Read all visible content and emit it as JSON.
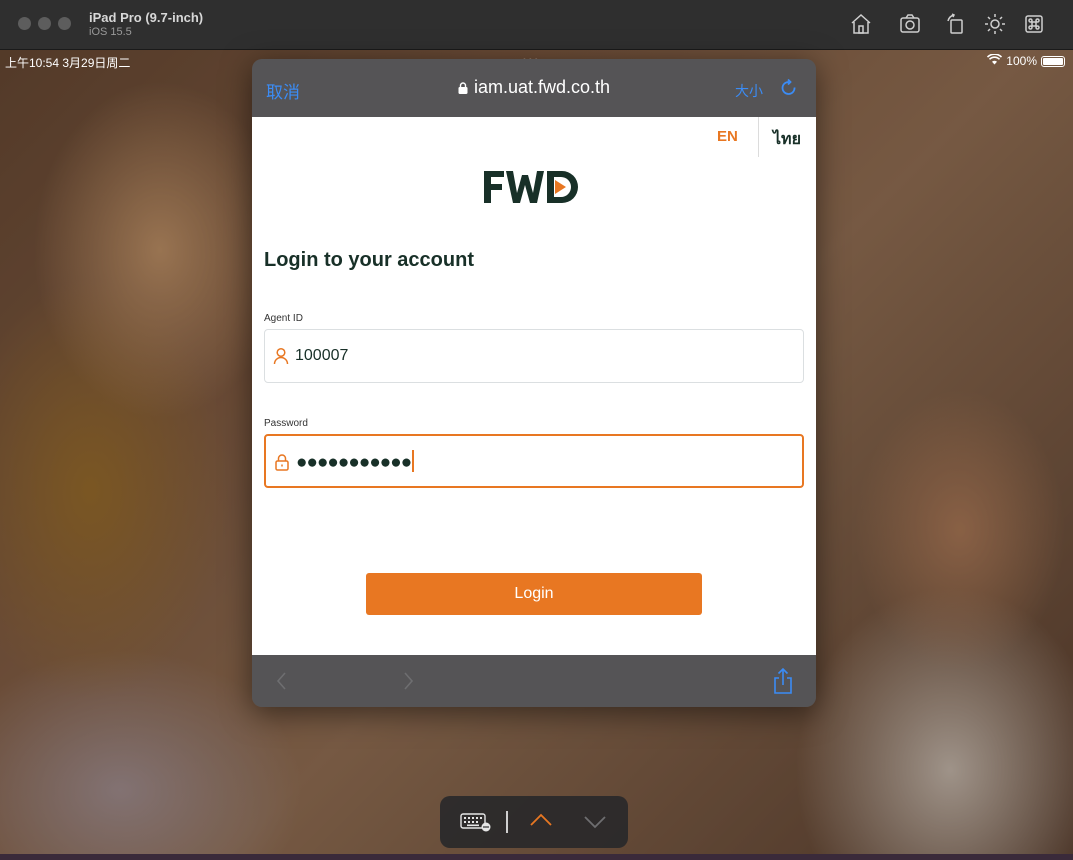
{
  "simulator": {
    "device_name": "iPad Pro (9.7-inch)",
    "os_version": "iOS 15.5",
    "toolbar_icons": [
      "home-icon",
      "screenshot-icon",
      "rotate-icon",
      "appearance-icon",
      "command-icon"
    ]
  },
  "status_bar": {
    "time_date": "上午10:54 3月29日周二",
    "multitask_dots": "•••",
    "battery": "100%",
    "battery_level": 1.0
  },
  "browser": {
    "cancel_label": "取消",
    "url": "iam.uat.fwd.co.th",
    "text_size_label": "大小"
  },
  "login_page": {
    "lang_en": "EN",
    "lang_th": "ไทย",
    "logo_text": "FWD",
    "heading": "Login to your account",
    "agent_id_label": "Agent ID",
    "agent_id_value": "100007",
    "password_label": "Password",
    "password_mask": "●●●●●●●●●●●",
    "login_button": "Login"
  },
  "colors": {
    "accent": "#e87722",
    "brand_dark": "#183028",
    "ios_blue": "#3b8cf5"
  }
}
